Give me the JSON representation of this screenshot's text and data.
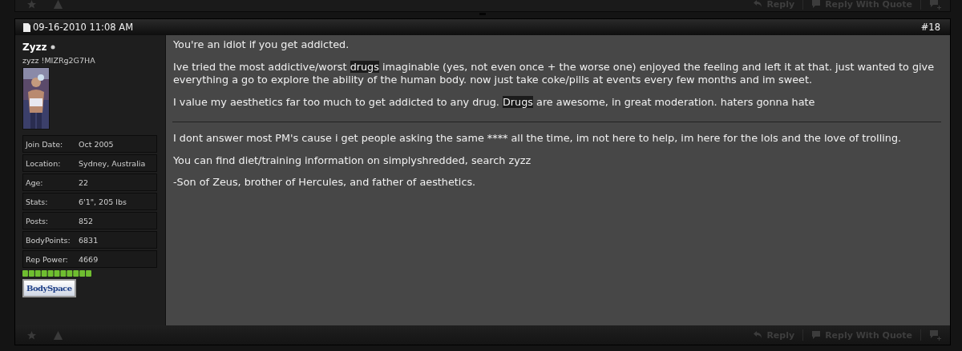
{
  "previous_post_footer": {
    "buttons": [
      {
        "kind": "reply",
        "label": "Reply"
      },
      {
        "kind": "quote",
        "label": "Reply With Quote"
      },
      {
        "kind": "multiquote"
      }
    ]
  },
  "post": {
    "date": "09-16-2010 11:08 AM",
    "number": "#18",
    "user": {
      "name": "Zyzz",
      "online": true,
      "title": "zyzz !MIZRg2G7HA",
      "details": [
        {
          "label": "Join Date:",
          "value": "Oct 2005"
        },
        {
          "label": "Location:",
          "value": "Sydney, Australia"
        },
        {
          "label": "Age:",
          "value": "22"
        },
        {
          "label": "Stats:",
          "value": "6'1\", 205 lbs"
        },
        {
          "label": "Posts:",
          "value": "852"
        },
        {
          "label": "BodyPoints:",
          "value": "6831"
        },
        {
          "label": "Rep Power:",
          "value": "4669"
        }
      ],
      "bodyspace_button": "BodySpace"
    },
    "message": [
      [
        {
          "text": "You're an idiot if you get addicted.",
          "highlighted": false
        }
      ],
      [
        {
          "text": "Ive tried the most addictive/worst ",
          "highlighted": false
        },
        {
          "text": "drugs",
          "highlighted": true
        },
        {
          "text": " imaginable (yes, not even once + the worse one) enjoyed the feeling and left it at that. just wanted to give everything a go to explore the ability of the human body. now just take coke/pills at events every few months and im sweet.",
          "highlighted": false
        }
      ],
      [
        {
          "text": "I value my aesthetics far too much to get addicted to any drug. ",
          "highlighted": false
        },
        {
          "text": "Drugs",
          "highlighted": true
        },
        {
          "text": " are awesome, in great moderation. haters gonna hate",
          "highlighted": false
        }
      ]
    ],
    "signature": [
      "I dont answer most PM's cause i get people asking the same **** all the time, im not here to help, im here for the lols and the love of trolling.",
      "You can find diet/training information on simplyshredded, search zyzz",
      "-Son of Zeus, brother of Hercules, and father of aesthetics."
    ],
    "footer": {
      "buttons": [
        {
          "kind": "reply",
          "label": "Reply"
        },
        {
          "kind": "quote",
          "label": "Reply With Quote"
        },
        {
          "kind": "multiquote"
        }
      ]
    }
  }
}
